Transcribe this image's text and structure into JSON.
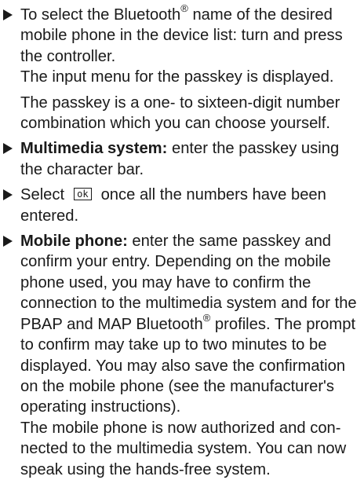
{
  "superscript_mark": "®",
  "steps": {
    "step1": {
      "text_a": "To select the Bluetooth",
      "text_b": " name of the desired mobile phone in the device list: turn and press the controller."
    },
    "note1": "The input menu for the passkey is displayed.",
    "note2": "The passkey is a one- to sixteen-digit number combination which you can choose yourself.",
    "step2": {
      "bold": "Multimedia system:",
      "text": " enter the passkey using the character bar."
    },
    "step3": {
      "before": "Select",
      "button": "ok",
      "after": "once all the numbers have been entered."
    },
    "step4": {
      "bold": "Mobile phone:",
      "text_a": " enter the same passkey and confirm your entry. Depending on the mobile phone used, you may have to confirm the connection to the multimedia system and for the PBAP and MAP Bluetooth",
      "text_b": " profiles. The prompt to confirm may take up to two minutes to be displayed. You may also save the confirmation on the mobile phone (see the manufacturer's operating instructions).",
      "text_c": "The mobile phone is now authorized and con-nected to the multimedia system. You can now speak using the hands-free system."
    }
  }
}
